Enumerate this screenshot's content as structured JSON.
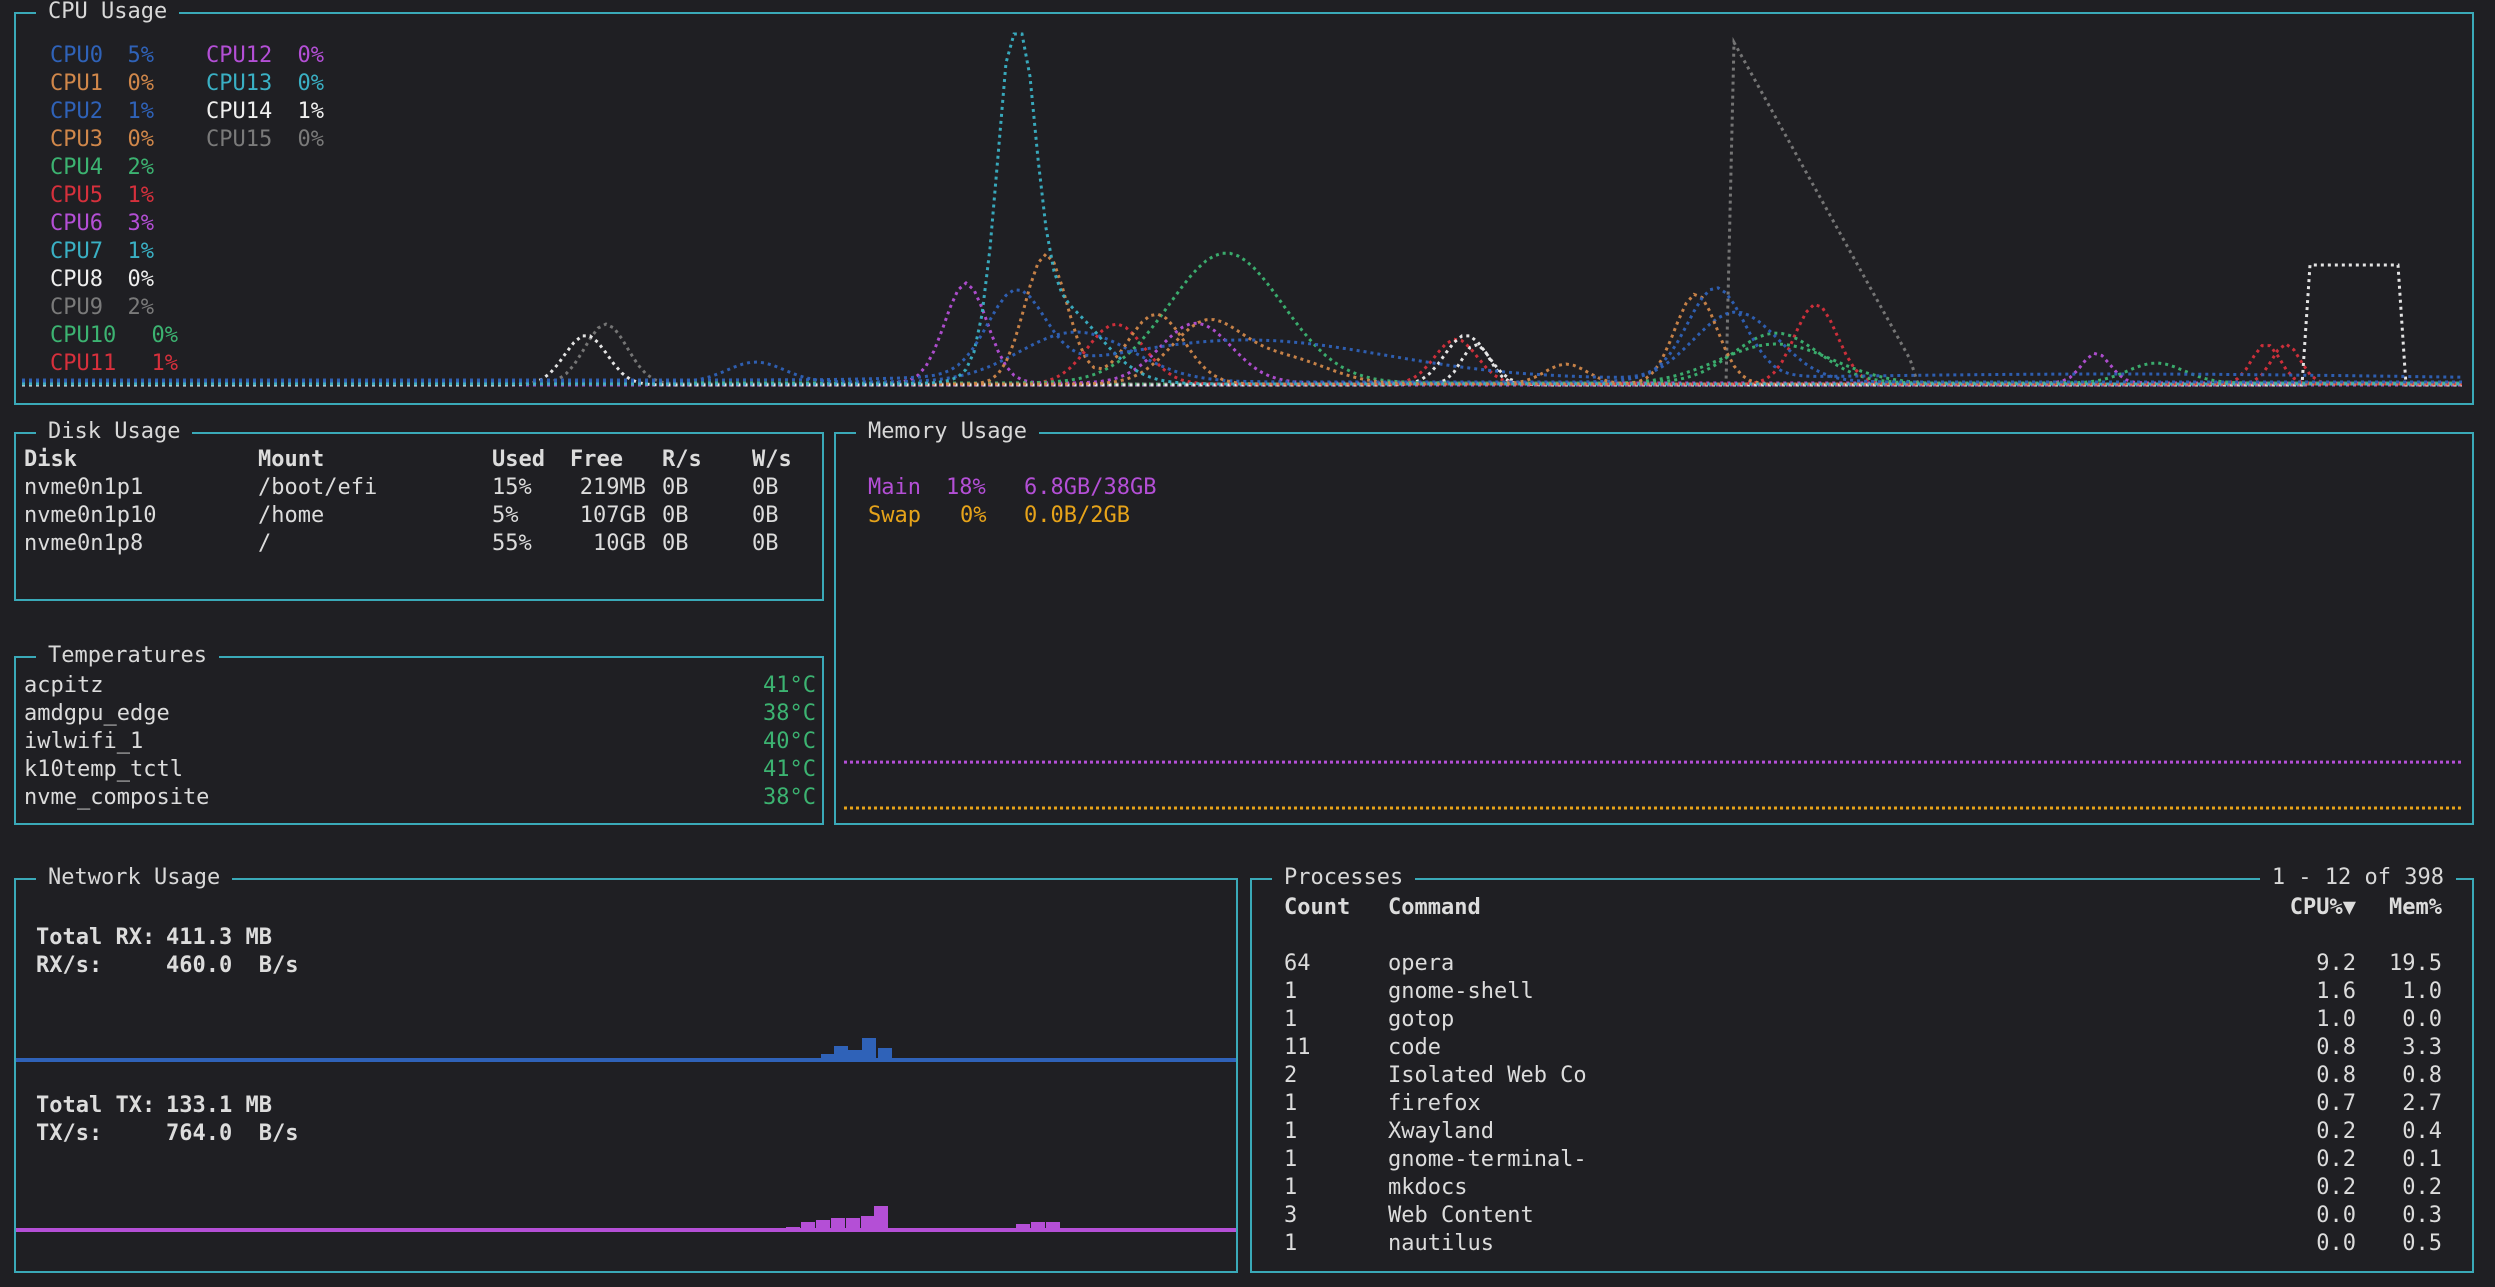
{
  "colors": {
    "border": "#3aa9b8",
    "background": "#1f1f23",
    "text": "#dcdcdc",
    "green": "#3cb371",
    "main_mem": "#b44fd6",
    "swap_mem": "#e6a31a",
    "rx": "#2f62b8",
    "tx": "#b44fd6"
  },
  "cpu": {
    "title": "CPU Usage",
    "cores": [
      {
        "name": "CPU0",
        "pct": "5%",
        "color": "#2f62b8"
      },
      {
        "name": "CPU1",
        "pct": "0%",
        "color": "#d0874a"
      },
      {
        "name": "CPU2",
        "pct": "1%",
        "color": "#2f62b8"
      },
      {
        "name": "CPU3",
        "pct": "0%",
        "color": "#d0874a"
      },
      {
        "name": "CPU4",
        "pct": "2%",
        "color": "#3cb371"
      },
      {
        "name": "CPU5",
        "pct": "1%",
        "color": "#d6303c"
      },
      {
        "name": "CPU6",
        "pct": "3%",
        "color": "#b44fd6"
      },
      {
        "name": "CPU7",
        "pct": "1%",
        "color": "#3ab0c4"
      },
      {
        "name": "CPU8",
        "pct": "0%",
        "color": "#eeeeee"
      },
      {
        "name": "CPU9",
        "pct": "2%",
        "color": "#7a7a7a"
      },
      {
        "name": "CPU10",
        "pct": "0%",
        "color": "#3cb371"
      },
      {
        "name": "CPU11",
        "pct": "1%",
        "color": "#d6303c"
      },
      {
        "name": "CPU12",
        "pct": "0%",
        "color": "#b44fd6"
      },
      {
        "name": "CPU13",
        "pct": "0%",
        "color": "#3ab0c4"
      },
      {
        "name": "CPU14",
        "pct": "1%",
        "color": "#eeeeee"
      },
      {
        "name": "CPU15",
        "pct": "0%",
        "color": "#7a7a7a"
      }
    ]
  },
  "disk": {
    "title": "Disk Usage",
    "headers": {
      "disk": "Disk",
      "mount": "Mount",
      "used": "Used",
      "free": "Free",
      "rs": "R/s",
      "ws": "W/s"
    },
    "rows": [
      {
        "disk": "nvme0n1p1",
        "mount": "/boot/efi",
        "used": "15%",
        "free": "219MB",
        "rs": "0B",
        "ws": "0B"
      },
      {
        "disk": "nvme0n1p10",
        "mount": "/home",
        "used": "5%",
        "free": "107GB",
        "rs": "0B",
        "ws": "0B"
      },
      {
        "disk": "nvme0n1p8",
        "mount": "/",
        "used": "55%",
        "free": "10GB",
        "rs": "0B",
        "ws": "0B"
      }
    ]
  },
  "temps": {
    "title": "Temperatures",
    "rows": [
      {
        "name": "acpitz",
        "value": "41°C"
      },
      {
        "name": "amdgpu_edge",
        "value": "38°C"
      },
      {
        "name": "iwlwifi_1",
        "value": "40°C"
      },
      {
        "name": "k10temp_tctl",
        "value": "41°C"
      },
      {
        "name": "nvme_composite",
        "value": "38°C"
      }
    ]
  },
  "memory": {
    "title": "Memory Usage",
    "main": {
      "label": "Main",
      "pct": "18%",
      "amount": "6.8GB/38GB",
      "value": 0.18
    },
    "swap": {
      "label": "Swap",
      "pct": "0%",
      "amount": "0.0B/2GB",
      "value": 0.0
    }
  },
  "network": {
    "title": "Network Usage",
    "total_rx_label": "Total RX:",
    "total_rx": "411.3 MB",
    "rx_rate_label": "RX/s:",
    "rx_rate": "460.0  B/s",
    "total_tx_label": "Total TX:",
    "total_tx": "133.1 MB",
    "tx_rate_label": "TX/s:",
    "tx_rate": "764.0  B/s"
  },
  "processes": {
    "title": "Processes",
    "range": "1 - 12 of 398",
    "headers": {
      "count": "Count",
      "command": "Command",
      "cpu": "CPU%▼",
      "mem": "Mem%"
    },
    "rows": [
      {
        "count": "64",
        "command": "opera",
        "cpu": "9.2",
        "mem": "19.5"
      },
      {
        "count": "1",
        "command": "gnome-shell",
        "cpu": "1.6",
        "mem": "1.0"
      },
      {
        "count": "1",
        "command": "gotop",
        "cpu": "1.0",
        "mem": "0.0"
      },
      {
        "count": "11",
        "command": "code",
        "cpu": "0.8",
        "mem": "3.3"
      },
      {
        "count": "2",
        "command": "Isolated Web Co",
        "cpu": "0.8",
        "mem": "0.8"
      },
      {
        "count": "1",
        "command": "firefox",
        "cpu": "0.7",
        "mem": "2.7"
      },
      {
        "count": "1",
        "command": "Xwayland",
        "cpu": "0.2",
        "mem": "0.4"
      },
      {
        "count": "1",
        "command": "gnome-terminal-",
        "cpu": "0.2",
        "mem": "0.1"
      },
      {
        "count": "1",
        "command": "mkdocs",
        "cpu": "0.2",
        "mem": "0.2"
      },
      {
        "count": "3",
        "command": "Web Content",
        "cpu": "0.0",
        "mem": "0.3"
      },
      {
        "count": "1",
        "command": "nautilus",
        "cpu": "0.0",
        "mem": "0.5"
      }
    ]
  }
}
